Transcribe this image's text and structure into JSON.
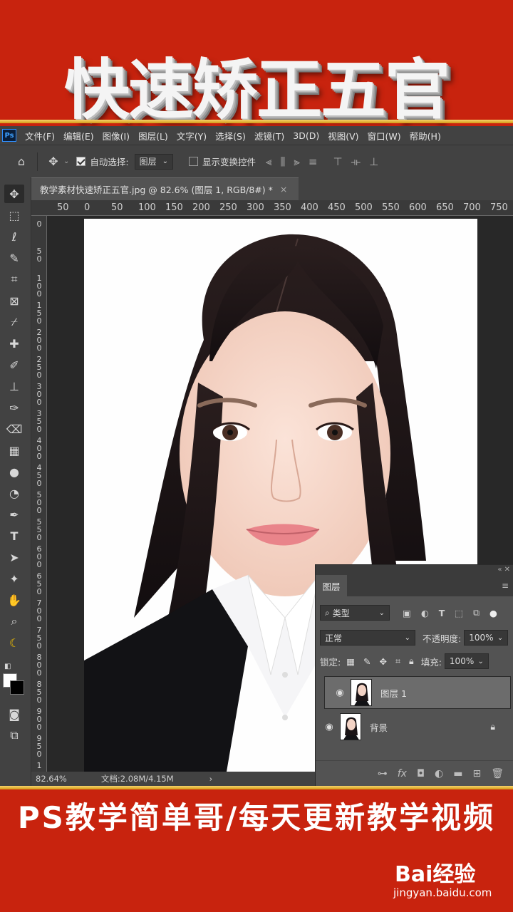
{
  "banner": {
    "title": "快速矫正五官",
    "subtitle": "PS教学简单哥/每天更新教学视频"
  },
  "watermark": {
    "brand": "Bai经验",
    "url": "jingyan.baidu.com"
  },
  "app": {
    "logo": "Ps"
  },
  "menu": [
    "文件(F)",
    "编辑(E)",
    "图像(I)",
    "图层(L)",
    "文字(Y)",
    "选择(S)",
    "滤镜(T)",
    "3D(D)",
    "视图(V)",
    "窗口(W)",
    "帮助(H)"
  ],
  "options": {
    "auto_select_label": "自动选择:",
    "auto_select_value": "图层",
    "show_transform_label": "显示变换控件"
  },
  "document": {
    "tab_title": "教学素材快速矫正五官.jpg @ 82.6% (图层 1, RGB/8#) *",
    "close": "×"
  },
  "ruler": {
    "h_ticks": [
      "50",
      "0",
      "50",
      "100",
      "150",
      "200",
      "250",
      "300",
      "350",
      "400",
      "450",
      "500",
      "550",
      "600",
      "650",
      "700",
      "750"
    ],
    "v_ticks": [
      "0",
      "5\n0",
      "1\n0\n0",
      "1\n5\n0",
      "2\n0\n0",
      "2\n5\n0",
      "3\n0\n0",
      "3\n5\n0",
      "4\n0\n0",
      "4\n5\n0",
      "5\n0\n0",
      "5\n5\n0",
      "6\n0\n0",
      "6\n5\n0",
      "7\n0\n0",
      "7\n5\n0",
      "8\n0\n0",
      "8\n5\n0",
      "9\n0\n0",
      "9\n5\n0",
      "1"
    ]
  },
  "status": {
    "zoom": "82.64%",
    "doc_size": "文档:2.08M/4.15M",
    "arrow": "›"
  },
  "layers_panel": {
    "tab": "图层",
    "kind_label": "类型",
    "blend_mode": "正常",
    "opacity_label": "不透明度:",
    "opacity_value": "100%",
    "lock_label": "锁定:",
    "fill_label": "填充:",
    "fill_value": "100%",
    "layers": [
      {
        "name": "图层 1",
        "selected": true
      },
      {
        "name": "背景",
        "locked": true
      }
    ]
  },
  "colors": {
    "banner_red": "#c8230e",
    "accent_gold": "#e8b23a",
    "ps_dark": "#424242",
    "ps_mid": "#535353"
  }
}
